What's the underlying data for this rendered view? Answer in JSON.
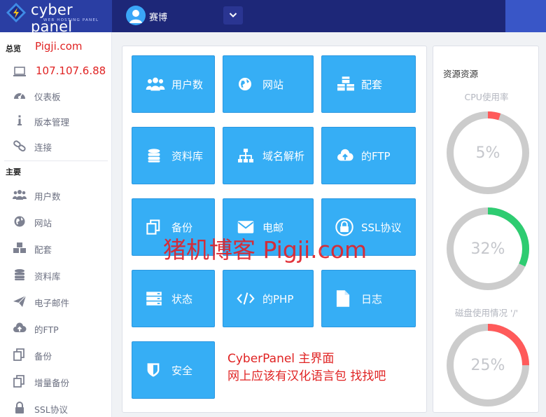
{
  "header": {
    "brand_name": "cyber panel",
    "brand_sub": "WEB HOSTING PANEL",
    "username": "赛博",
    "colors": {
      "bar": "#1d2778",
      "brand": "#2a3ea3"
    }
  },
  "sidebar": {
    "overview_title": "总览",
    "overview_note": "Pigji.com",
    "ip_address": "107.107.6.88",
    "overview_items": [
      {
        "label": "仪表板",
        "icon": "dashboard-icon"
      },
      {
        "label": "版本管理",
        "icon": "info-icon"
      },
      {
        "label": "连接",
        "icon": "link-icon"
      }
    ],
    "main_title": "主要",
    "main_items": [
      {
        "label": "用户数",
        "icon": "users-icon"
      },
      {
        "label": "网站",
        "icon": "globe-icon"
      },
      {
        "label": "配套",
        "icon": "packages-icon"
      },
      {
        "label": "资料库",
        "icon": "database-icon"
      },
      {
        "label": "电子邮件",
        "icon": "paper-plane-icon"
      },
      {
        "label": "的FTP",
        "icon": "cloud-upload-icon"
      },
      {
        "label": "备份",
        "icon": "copy-icon"
      },
      {
        "label": "增量备份",
        "icon": "copy-icon"
      },
      {
        "label": "SSL协议",
        "icon": "lock-icon"
      }
    ]
  },
  "tiles": [
    {
      "label": "用户数",
      "icon": "users-icon"
    },
    {
      "label": "网站",
      "icon": "globe-icon"
    },
    {
      "label": "配套",
      "icon": "cubes-icon"
    },
    {
      "label": "资料库",
      "icon": "database-icon"
    },
    {
      "label": "域名解析",
      "icon": "sitemap-icon"
    },
    {
      "label": "的FTP",
      "icon": "cloud-upload-icon"
    },
    {
      "label": "备份",
      "icon": "copy-icon"
    },
    {
      "label": "电邮",
      "icon": "envelope-icon"
    },
    {
      "label": "SSL协议",
      "icon": "lock-icon"
    },
    {
      "label": "状态",
      "icon": "server-icon"
    },
    {
      "label": "的PHP",
      "icon": "code-icon"
    },
    {
      "label": "日志",
      "icon": "file-icon"
    },
    {
      "label": "安全",
      "icon": "shield-icon"
    }
  ],
  "annotations": {
    "watermark": "猪机博客 Pigji.com",
    "note_line1": "CyberPanel 主界面",
    "note_line2": "网上应该有汉化语言包 找找吧"
  },
  "resources": {
    "title": "资源资源",
    "gauges": [
      {
        "label": "CPU使用率",
        "value_text": "5%",
        "percent": 5,
        "color": "#ff5a5a"
      },
      {
        "label": "",
        "value_text": "32%",
        "percent": 32,
        "color": "#2ecc71"
      },
      {
        "label": "磁盘使用情况 '/'",
        "value_text": "25%",
        "percent": 25,
        "color": "#ff5a5a"
      }
    ],
    "track_color": "#cccccc"
  },
  "colors": {
    "tile": "#36aef5",
    "accent_red": "#e02323"
  }
}
